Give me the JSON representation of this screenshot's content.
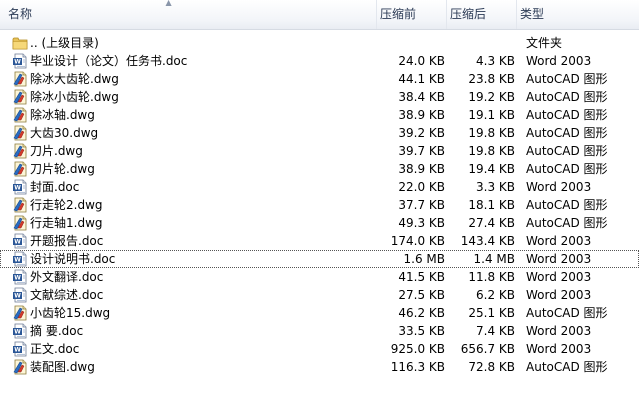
{
  "header": {
    "name": "名称",
    "compressed": "压缩前",
    "size": "压缩后",
    "type": "类型"
  },
  "icons": {
    "folder": "folder-icon",
    "word": "word-doc-icon",
    "autocad": "autocad-dwg-icon"
  },
  "files": [
    {
      "icon": "folder",
      "name": ".. (上级目录)",
      "compressed": "",
      "size": "",
      "type": "文件夹"
    },
    {
      "icon": "word",
      "name": "毕业设计（论文）任务书.doc",
      "compressed": "24.0 KB",
      "size": "4.3 KB",
      "type": "Word 2003"
    },
    {
      "icon": "autocad",
      "name": "除冰大齿轮.dwg",
      "compressed": "44.1 KB",
      "size": "23.8 KB",
      "type": "AutoCAD 图形"
    },
    {
      "icon": "autocad",
      "name": "除冰小齿轮.dwg",
      "compressed": "38.4 KB",
      "size": "19.2 KB",
      "type": "AutoCAD 图形"
    },
    {
      "icon": "autocad",
      "name": "除冰轴.dwg",
      "compressed": "38.9 KB",
      "size": "19.1 KB",
      "type": "AutoCAD 图形"
    },
    {
      "icon": "autocad",
      "name": "大齿30.dwg",
      "compressed": "39.2 KB",
      "size": "19.8 KB",
      "type": "AutoCAD 图形"
    },
    {
      "icon": "autocad",
      "name": "刀片.dwg",
      "compressed": "39.7 KB",
      "size": "19.8 KB",
      "type": "AutoCAD 图形"
    },
    {
      "icon": "autocad",
      "name": "刀片轮.dwg",
      "compressed": "38.9 KB",
      "size": "19.4 KB",
      "type": "AutoCAD 图形"
    },
    {
      "icon": "word",
      "name": "封面.doc",
      "compressed": "22.0 KB",
      "size": "3.3 KB",
      "type": "Word 2003"
    },
    {
      "icon": "autocad",
      "name": "行走轮2.dwg",
      "compressed": "37.7 KB",
      "size": "18.1 KB",
      "type": "AutoCAD 图形"
    },
    {
      "icon": "autocad",
      "name": "行走轴1.dwg",
      "compressed": "49.3 KB",
      "size": "27.4 KB",
      "type": "AutoCAD 图形"
    },
    {
      "icon": "word",
      "name": "开题报告.doc",
      "compressed": "174.0 KB",
      "size": "143.4 KB",
      "type": "Word 2003"
    },
    {
      "icon": "word",
      "name": "设计说明书.doc",
      "compressed": "1.6 MB",
      "size": "1.4 MB",
      "type": "Word 2003",
      "focused": true
    },
    {
      "icon": "word",
      "name": "外文翻译.doc",
      "compressed": "41.5 KB",
      "size": "11.8 KB",
      "type": "Word 2003"
    },
    {
      "icon": "word",
      "name": "文献综述.doc",
      "compressed": "27.5 KB",
      "size": "6.2 KB",
      "type": "Word 2003"
    },
    {
      "icon": "autocad",
      "name": "小齿轮15.dwg",
      "compressed": "46.2 KB",
      "size": "25.1 KB",
      "type": "AutoCAD 图形"
    },
    {
      "icon": "word",
      "name": "摘  要.doc",
      "compressed": "33.5 KB",
      "size": "7.4 KB",
      "type": "Word 2003"
    },
    {
      "icon": "word",
      "name": "正文.doc",
      "compressed": "925.0 KB",
      "size": "656.7 KB",
      "type": "Word 2003"
    },
    {
      "icon": "autocad",
      "name": "装配图.dwg",
      "compressed": "116.3 KB",
      "size": "72.8 KB",
      "type": "AutoCAD 图形"
    }
  ]
}
